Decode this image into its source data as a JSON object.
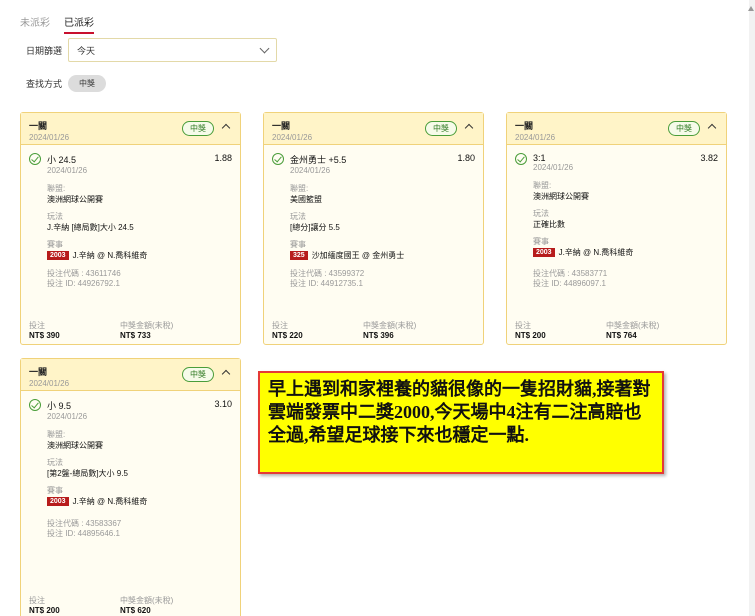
{
  "tabs": [
    {
      "label": "未派彩",
      "active": false
    },
    {
      "label": "已派彩",
      "active": true
    }
  ],
  "filter": {
    "label": "日期篩選",
    "value": "今天"
  },
  "method": {
    "label": "查找方式",
    "pill": "中獎"
  },
  "cards": [
    {
      "title": "一關",
      "date": "2024/01/26",
      "badge": "中獎",
      "selection": "小 24.5",
      "sel_date": "2024/01/26",
      "odds": "1.88",
      "league_label": "聯盟:",
      "league": "澳洲網球公開賽",
      "play_label": "玩法",
      "play": "J.辛納 [總局數]大小 24.5",
      "event_label": "賽事",
      "event_code": "2003",
      "event": "J.辛納 @ N.喬科維奇",
      "bet_code": "投注代碼 : 43611746",
      "bet_id": "投注 ID: 44926792.1",
      "stake_label": "投注",
      "stake": "NT$ 390",
      "win_label": "中獎金額(未稅)",
      "win": "NT$ 733"
    },
    {
      "title": "一關",
      "date": "2024/01/26",
      "badge": "中獎",
      "selection": "金州勇士 +5.5",
      "sel_date": "2024/01/26",
      "odds": "1.80",
      "league_label": "聯盟:",
      "league": "美國籃盟",
      "play_label": "玩法",
      "play": "[總分]讓分 5.5",
      "event_label": "賽事",
      "event_code": "325",
      "event": "沙加緬度國王 @ 金州勇士",
      "bet_code": "投注代碼 : 43599372",
      "bet_id": "投注 ID: 44912735.1",
      "stake_label": "投注",
      "stake": "NT$ 220",
      "win_label": "中獎金額(未稅)",
      "win": "NT$ 396"
    },
    {
      "title": "一關",
      "date": "2024/01/26",
      "badge": "中獎",
      "selection": "3:1",
      "sel_date": "2024/01/26",
      "odds": "3.82",
      "league_label": "聯盟:",
      "league": "澳洲網球公開賽",
      "play_label": "玩法",
      "play": "正確比數",
      "event_label": "賽事",
      "event_code": "2003",
      "event": "J.辛納 @ N.喬科維奇",
      "bet_code": "投注代碼 : 43583771",
      "bet_id": "投注 ID: 44896097.1",
      "stake_label": "投注",
      "stake": "NT$ 200",
      "win_label": "中獎金額(未稅)",
      "win": "NT$ 764"
    },
    {
      "title": "一關",
      "date": "2024/01/26",
      "badge": "中獎",
      "selection": "小 9.5",
      "sel_date": "2024/01/26",
      "odds": "3.10",
      "league_label": "聯盟:",
      "league": "澳洲網球公開賽",
      "play_label": "玩法",
      "play": "[第2盤-總局數]大小 9.5",
      "event_label": "賽事",
      "event_code": "2003",
      "event": "J.辛納 @ N.喬科維奇",
      "bet_code": "投注代碼 : 43583367",
      "bet_id": "投注 ID: 44895646.1",
      "stake_label": "投注",
      "stake": "NT$ 200",
      "win_label": "中獎金額(未稅)",
      "win": "NT$ 620"
    }
  ],
  "overlay_text": "早上遇到和家裡養的貓很像的一隻招財貓,接著對雲端發票中二獎2000,今天場中4注有二注高賠也全過,希望足球接下來也穩定一點."
}
